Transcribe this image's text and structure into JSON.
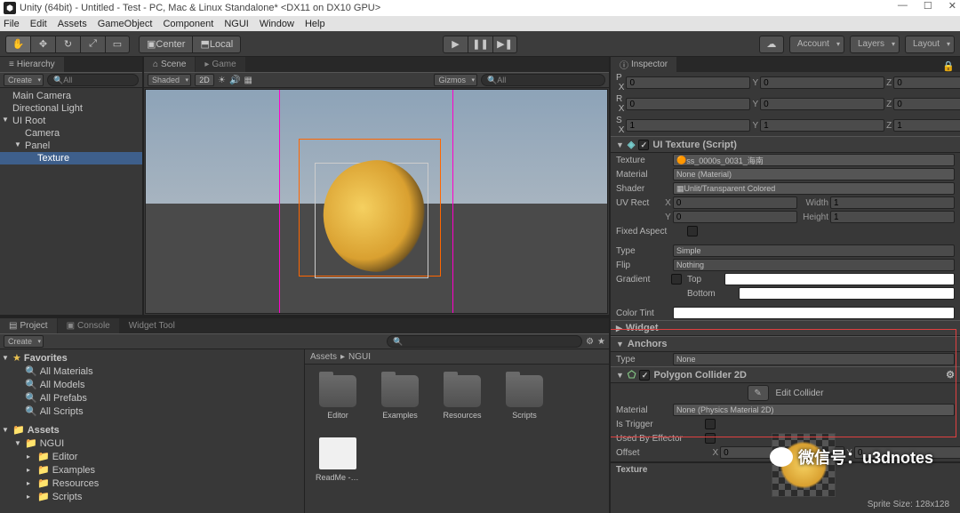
{
  "window": {
    "title": "Unity (64bit) - Untitled - Test - PC, Mac & Linux Standalone* <DX11 on DX10 GPU>"
  },
  "menu": [
    "File",
    "Edit",
    "Assets",
    "GameObject",
    "Component",
    "NGUI",
    "Window",
    "Help"
  ],
  "toolbar": {
    "center_label": "Center",
    "local_label": "Local",
    "account": "Account",
    "layers": "Layers",
    "layout": "Layout"
  },
  "hierarchy": {
    "tab": "Hierarchy",
    "create": "Create",
    "search_placeholder": "All",
    "items": [
      {
        "label": "Main Camera",
        "indent": 0
      },
      {
        "label": "Directional Light",
        "indent": 0
      },
      {
        "label": "UI Root",
        "indent": 0,
        "fold": "▼"
      },
      {
        "label": "Camera",
        "indent": 1
      },
      {
        "label": "Panel",
        "indent": 1,
        "fold": "▼"
      },
      {
        "label": "Texture",
        "indent": 2,
        "sel": true
      }
    ]
  },
  "scene": {
    "tab_scene": "Scene",
    "tab_game": "Game",
    "shading": "Shaded",
    "mode2d": "2D",
    "gizmos": "Gizmos",
    "search_placeholder": "All"
  },
  "inspector": {
    "tab": "Inspector",
    "transform": {
      "p": {
        "x": "0",
        "y": "0",
        "z": "0"
      },
      "r": {
        "x": "0",
        "y": "0",
        "z": "0"
      },
      "s": {
        "x": "1",
        "y": "1",
        "z": "1"
      }
    },
    "ui_texture": {
      "title": "UI Texture (Script)",
      "texture_label": "Texture",
      "texture_value": "ss_0000s_0031_海南",
      "material_label": "Material",
      "material_value": "None (Material)",
      "shader_label": "Shader",
      "shader_value": "Unlit/Transparent Colored",
      "uvrect_label": "UV Rect",
      "uv_x": "0",
      "uv_y": "0",
      "uv_w": "1",
      "uv_h": "1",
      "width_label": "Width",
      "height_label": "Height",
      "fixed_aspect_label": "Fixed Aspect",
      "type_label": "Type",
      "type_value": "Simple",
      "flip_label": "Flip",
      "flip_value": "Nothing",
      "gradient_label": "Gradient",
      "gradient_top": "Top",
      "gradient_bottom": "Bottom",
      "color_tint_label": "Color Tint",
      "widget_label": "Widget",
      "anchors_label": "Anchors",
      "anchors_type_label": "Type",
      "anchors_type_value": "None"
    },
    "poly": {
      "title": "Polygon Collider 2D",
      "edit_label": "Edit Collider",
      "material_label": "Material",
      "material_value": "None (Physics Material 2D)",
      "is_trigger_label": "Is Trigger",
      "used_by_label": "Used By Effector",
      "offset_label": "Offset",
      "offset_x": "0",
      "offset_y": "0"
    },
    "footer_name": "Texture",
    "sprite_size": "Sprite Size: 128x128"
  },
  "project": {
    "tab_project": "Project",
    "tab_console": "Console",
    "tab_widget": "Widget Tool",
    "create": "Create",
    "favorites": "Favorites",
    "fav_items": [
      "All Materials",
      "All Models",
      "All Prefabs",
      "All Scripts"
    ],
    "assets": "Assets",
    "asset_tree": [
      "NGUI",
      "Editor",
      "Examples",
      "Resources",
      "Scripts"
    ],
    "breadcrumb": [
      "Assets",
      "NGUI"
    ],
    "grid": [
      "Editor",
      "Examples",
      "Resources",
      "Scripts",
      "ReadMe - 3..."
    ]
  },
  "watermark": "微信号：u3dnotes"
}
